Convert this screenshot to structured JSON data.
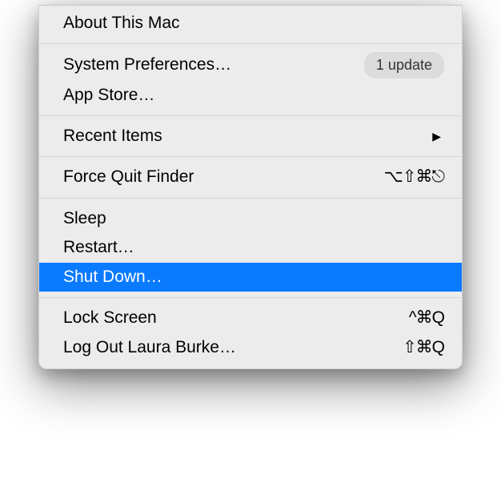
{
  "menu": {
    "about": "About This Mac",
    "system_prefs": "System Preferences…",
    "system_prefs_badge": "1 update",
    "app_store": "App Store…",
    "recent_items": "Recent Items",
    "force_quit": "Force Quit Finder",
    "force_quit_shortcut": "⌥⇧⌘⎋",
    "sleep": "Sleep",
    "restart": "Restart…",
    "shut_down": "Shut Down…",
    "lock_screen": "Lock Screen",
    "lock_screen_shortcut": "^⌘Q",
    "log_out": "Log Out Laura Burke…",
    "log_out_shortcut": "⇧⌘Q"
  }
}
